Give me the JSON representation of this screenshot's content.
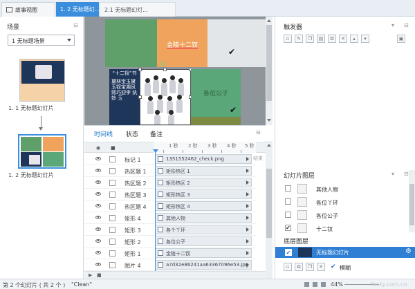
{
  "tabs": [
    {
      "label": "故事视图",
      "icon": "story-view-icon"
    },
    {
      "label": "1. 2 无标题幻...",
      "active": true
    },
    {
      "label": "2.1 无标题幻灯..."
    }
  ],
  "left": {
    "title": "场景",
    "scene_select": "1 无标题场景",
    "slides": [
      {
        "label": "1. 1 无标题幻灯片"
      },
      {
        "label": "1. 2 无标题幻灯片"
      }
    ]
  },
  "canvas": {
    "orange_label": "金陵十二钗",
    "green_label": "各位公子",
    "navy_title": "“十二钗”书",
    "navy_text": "黛林宝玉黛玉钗宝湘凤熙巧迎李 纨 妙 玉"
  },
  "timeline": {
    "tabs": [
      "时间线",
      "状态",
      "备注"
    ],
    "ruler": [
      "1 秒",
      "2 秒",
      "3 秒",
      "4 秒",
      "5 秒"
    ],
    "end_label": "结束",
    "rows": [
      {
        "name": "标记 1",
        "bar": "1351552462_check.png",
        "icon": "image-icon"
      },
      {
        "name": "热区题 1",
        "bar": "矩形热区 1",
        "icon": "hotspot-icon"
      },
      {
        "name": "热区题 2",
        "bar": "矩形热区 2",
        "icon": "hotspot-icon"
      },
      {
        "name": "热区题 3",
        "bar": "矩形热区 3",
        "icon": "hotspot-icon"
      },
      {
        "name": "热区题 4",
        "bar": "矩形热区 4",
        "icon": "hotspot-icon"
      },
      {
        "name": "矩形 4",
        "bar": "其他人物",
        "icon": "rectangle-icon"
      },
      {
        "name": "矩形 3",
        "bar": "各个丫环",
        "icon": "rectangle-icon"
      },
      {
        "name": "矩形 2",
        "bar": "各位公子",
        "icon": "rectangle-icon"
      },
      {
        "name": "矩形 1",
        "bar": "金陵十二钗",
        "icon": "rectangle-icon"
      },
      {
        "name": "图片 4",
        "bar": "a7d32e86241aa63367096e53.jpg",
        "icon": "image-icon"
      }
    ]
  },
  "right": {
    "trigger_title": "触发器",
    "layers_title": "幻灯片图层",
    "layers": [
      {
        "label": "其他人物",
        "checked": false
      },
      {
        "label": "各位丫环",
        "checked": false
      },
      {
        "label": "各位公子",
        "checked": false
      },
      {
        "label": "十二钗",
        "checked": true
      }
    ],
    "base_title": "底层图层",
    "base_layer": "无标题幻灯片",
    "dim_label": "模糊"
  },
  "status": {
    "slide_info": "第 2 个幻灯片 ( 共 2 个 )",
    "theme": "\"Clean\"",
    "zoom": "44%",
    "watermark": "Yesky.com.cn"
  },
  "colors": {
    "accent": "#3a8edc",
    "green": "#5e9f6a",
    "orange": "#f0a35c",
    "navy": "#1e3659"
  }
}
